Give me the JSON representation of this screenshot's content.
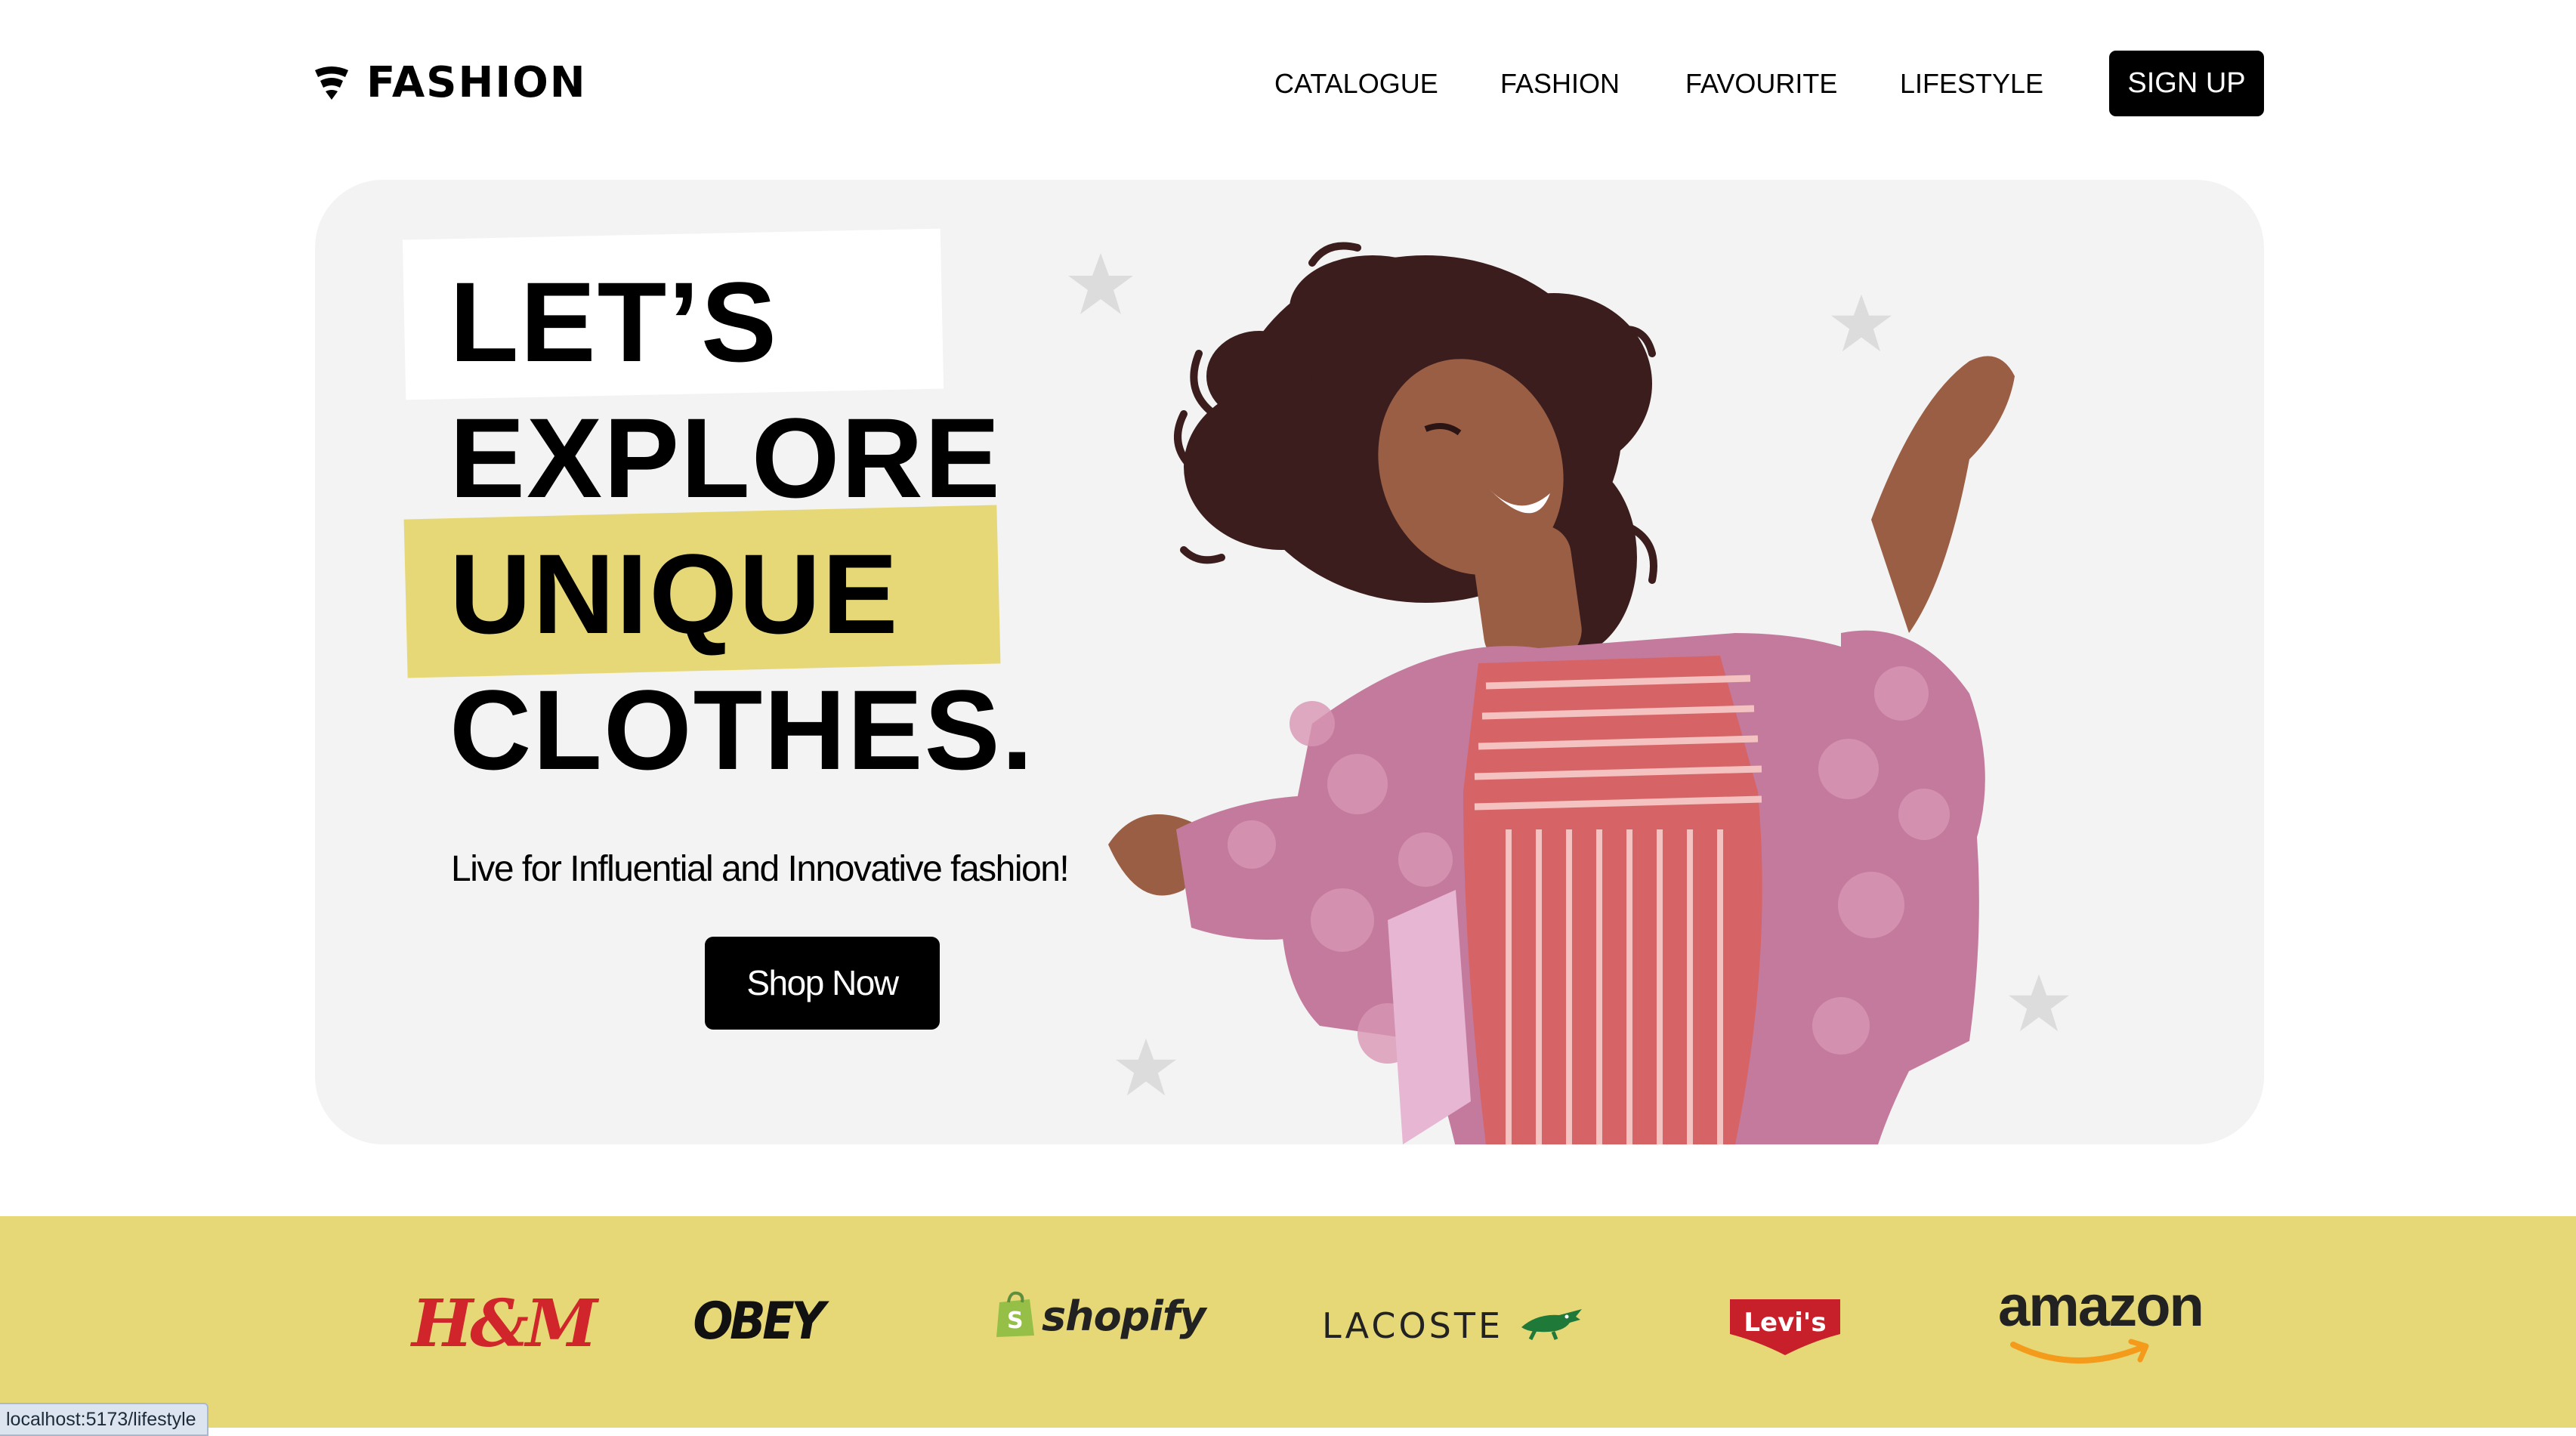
{
  "header": {
    "logo_text": "FASHION",
    "nav": [
      {
        "label": "CATALOGUE"
      },
      {
        "label": "FASHION"
      },
      {
        "label": "FAVOURITE"
      },
      {
        "label": "LIFESTYLE"
      }
    ],
    "signup_label": "SIGN UP"
  },
  "hero": {
    "headline": [
      "LET’S",
      "EXPLORE",
      "UNIQUE",
      "CLOTHES."
    ],
    "subtitle": "Live for Influential and Innovative fashion!",
    "cta_label": "Shop Now",
    "highlight_color": "#e7d877",
    "panel_color": "#f2f3f2"
  },
  "brands": {
    "background": "#e6d877",
    "items": [
      {
        "name": "H&M",
        "text": "H&M"
      },
      {
        "name": "OBEY",
        "text": "OBEY"
      },
      {
        "name": "shopify",
        "text": "shopify"
      },
      {
        "name": "LACOSTE",
        "text": "LACOSTE"
      },
      {
        "name": "Levi's",
        "text": "Levi's"
      },
      {
        "name": "amazon",
        "text": "amazon"
      }
    ]
  },
  "status_bar": {
    "url": "localhost:5173/lifestyle"
  }
}
